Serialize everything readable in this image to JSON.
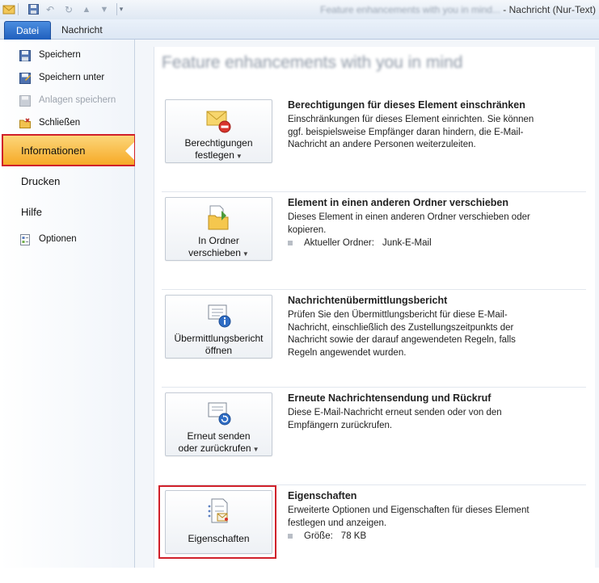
{
  "window": {
    "title_blurred": "Feature enhancements with you in mind...",
    "title_sep": " - ",
    "title_main": "Nachricht (Nur-Text)"
  },
  "ribbon": {
    "tabs": [
      {
        "label": "Datei",
        "active": true
      },
      {
        "label": "Nachricht",
        "active": false
      }
    ]
  },
  "nav": {
    "commands": [
      {
        "label": "Speichern",
        "icon": "save-icon",
        "enabled": true
      },
      {
        "label": "Speichern unter",
        "icon": "save-as-icon",
        "enabled": true
      },
      {
        "label": "Anlagen speichern",
        "icon": "save-attachments-icon",
        "enabled": false
      },
      {
        "label": "Schließen",
        "icon": "close-folder-icon",
        "enabled": true
      }
    ],
    "tabs": [
      {
        "label": "Informationen",
        "active": true
      },
      {
        "label": "Drucken",
        "active": false
      },
      {
        "label": "Hilfe",
        "active": false
      }
    ],
    "options_label": "Optionen"
  },
  "main": {
    "title_blurred": "Feature enhancements with you in mind",
    "sections": [
      {
        "button_label_1": "Berechtigungen",
        "button_label_2": "festlegen",
        "title": "Berechtigungen für dieses Element einschränken",
        "description": "Einschränkungen für dieses Element einrichten. Sie können ggf. beispielsweise Empfänger daran hindern, die E-Mail-Nachricht an andere Personen weiterzuleiten."
      },
      {
        "button_label_1": "In Ordner",
        "button_label_2": "verschieben",
        "title": "Element in einen anderen Ordner verschieben",
        "description": "Dieses Element in einen anderen Ordner verschieben oder kopieren.",
        "property_label": "Aktueller Ordner:",
        "property_value": "Junk-E-Mail"
      },
      {
        "button_label_1": "Übermittlungsbericht",
        "button_label_2": "öffnen",
        "title": "Nachrichtenübermittlungsbericht",
        "description": "Prüfen Sie den Übermittlungsbericht für diese E-Mail-Nachricht, einschließlich des Zustellungszeitpunkts der Nachricht sowie der darauf angewendeten Regeln, falls Regeln angewendet wurden."
      },
      {
        "button_label_1": "Erneut senden",
        "button_label_2": "oder zurückrufen",
        "title": "Erneute Nachrichtensendung und Rückruf",
        "description": "Diese E-Mail-Nachricht erneut senden oder von den Empfängern zurückrufen."
      },
      {
        "button_label_1": "Eigenschaften",
        "title": "Eigenschaften",
        "description": "Erweiterte Optionen und Eigenschaften für dieses Element festlegen und anzeigen.",
        "property_label": "Größe:",
        "property_value": "78 KB"
      }
    ]
  },
  "colors": {
    "active_nav": "#f6a722",
    "highlight_box": "#d0202a",
    "datei_tab": "#2a6ccc"
  }
}
